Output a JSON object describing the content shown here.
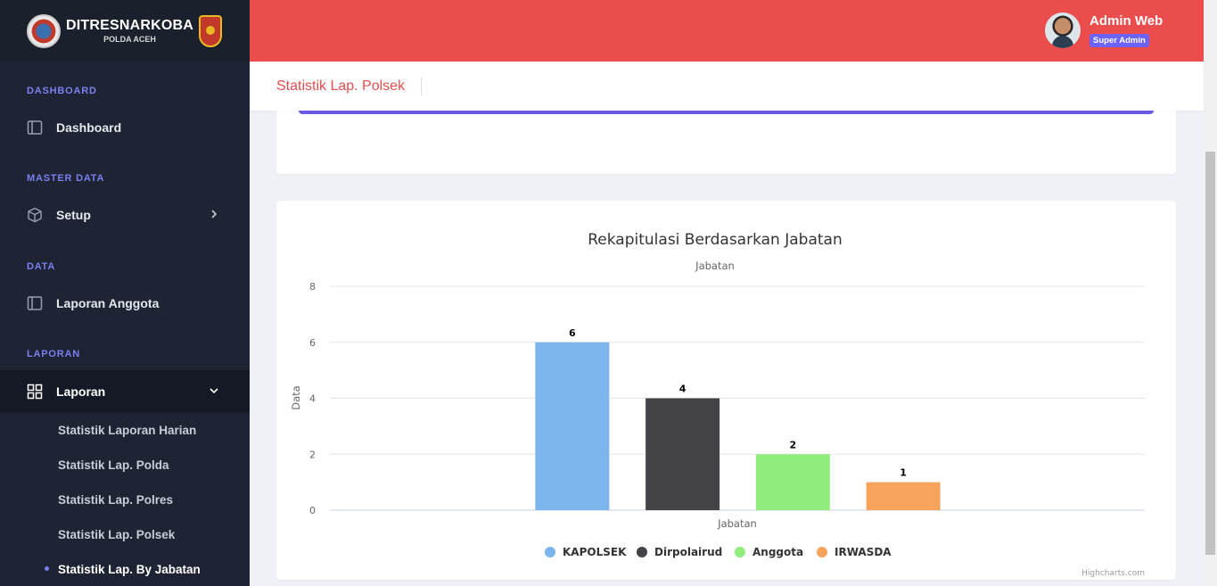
{
  "brand": {
    "title": "DITRESNARKOBA",
    "subtitle": "POLDA ACEH"
  },
  "sidebar": {
    "sections": [
      {
        "label": "DASHBOARD"
      },
      {
        "label": "MASTER DATA"
      },
      {
        "label": "DATA"
      },
      {
        "label": "LAPORAN"
      }
    ],
    "items": [
      {
        "label": "Dashboard",
        "icon": "panel-icon"
      },
      {
        "label": "Setup",
        "icon": "cube-icon"
      },
      {
        "label": "Laporan Anggota",
        "icon": "panel-icon"
      },
      {
        "label": "Laporan",
        "icon": "grid-icon"
      }
    ],
    "subitems": [
      {
        "label": "Statistik Laporan Harian"
      },
      {
        "label": "Statistik Lap. Polda"
      },
      {
        "label": "Statistik Lap. Polres"
      },
      {
        "label": "Statistik Lap. Polsek"
      },
      {
        "label": "Statistik Lap. By Jabatan"
      }
    ]
  },
  "header": {
    "user_name": "Admin Web",
    "user_role": "Super Admin"
  },
  "page": {
    "title": "Statistik Lap. Polsek"
  },
  "colors": {
    "topbar": "#eb4d4d",
    "accent": "#6c5ce7",
    "sidebar": "#1e2433"
  },
  "chart_data": {
    "type": "bar",
    "title": "Rekapitulasi Berdasarkan Jabatan",
    "subtitle": "Jabatan",
    "xlabel": "Jabatan",
    "ylabel": "Data",
    "ylim": [
      0,
      8
    ],
    "yticks": [
      0,
      2,
      4,
      6,
      8
    ],
    "grid": true,
    "legend_position": "bottom",
    "credits": "Highcharts.com",
    "series": [
      {
        "name": "KAPOLSEK",
        "values": [
          6
        ],
        "color": "#7cb5ec"
      },
      {
        "name": "Dirpolairud",
        "values": [
          4
        ],
        "color": "#434348"
      },
      {
        "name": "Anggota",
        "values": [
          2
        ],
        "color": "#90ed7d"
      },
      {
        "name": "IRWASDA",
        "values": [
          1
        ],
        "color": "#f7a35c"
      }
    ]
  }
}
